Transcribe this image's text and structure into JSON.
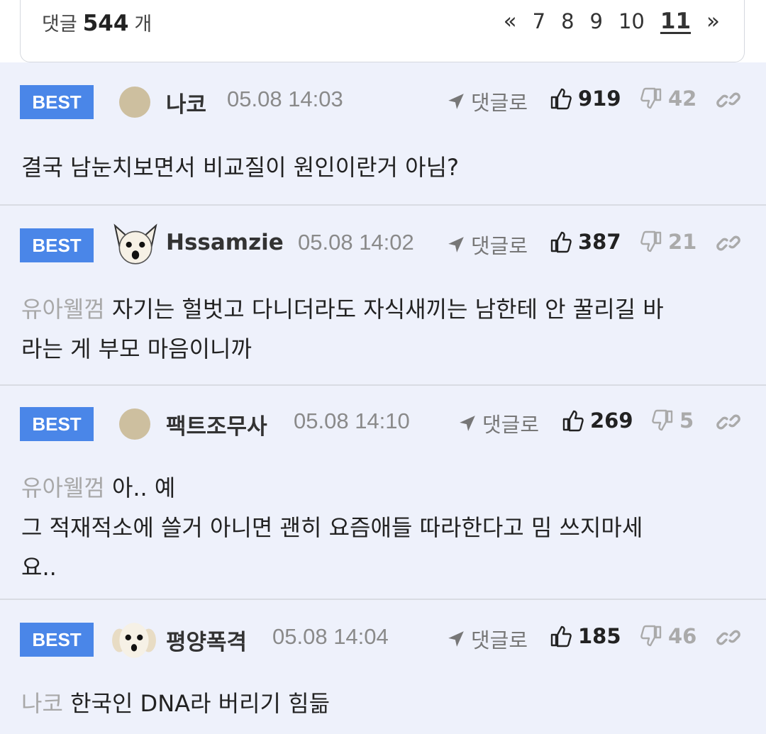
{
  "header": {
    "count_prefix": "댓글",
    "count_value": "544",
    "count_suffix": "개",
    "pager": {
      "prev_icon": "«",
      "pages": [
        "7",
        "8",
        "9",
        "10"
      ],
      "current": "11",
      "next_icon": "»"
    }
  },
  "ui": {
    "reply_label": "댓글로",
    "badge_label": "BEST",
    "accent_color": "#4a86e8"
  },
  "comments": [
    {
      "nick": "나코",
      "time": "05.08 14:03",
      "likes": "919",
      "dislikes": "42",
      "mention": "",
      "text": "결국 남눈치보면서 비교질이 원인이란거 아님?"
    },
    {
      "nick": "Hssamzie",
      "time": "05.08 14:02",
      "likes": "387",
      "dislikes": "21",
      "mention": "유아웰껌",
      "text_line1": "자기는 헐벗고 다니더라도 자식새끼는 남한테 안 꿀리길 바",
      "text_line2": "라는 게 부모 마음이니까"
    },
    {
      "nick": "팩트조무사",
      "time": "05.08 14:10",
      "likes": "269",
      "dislikes": "5",
      "mention": "유아웰껌",
      "text_line1": "아.. 예",
      "text_line2": "그 적재적소에 쓸거 아니면 괜히 요즘애들 따라한다고 밈 쓰지마세",
      "text_line3": "요.."
    },
    {
      "nick": "평양폭격",
      "time": "05.08 14:04",
      "likes": "185",
      "dislikes": "46",
      "mention": "나코",
      "text": "한국인 DNA라 버리기 힘듦"
    }
  ]
}
